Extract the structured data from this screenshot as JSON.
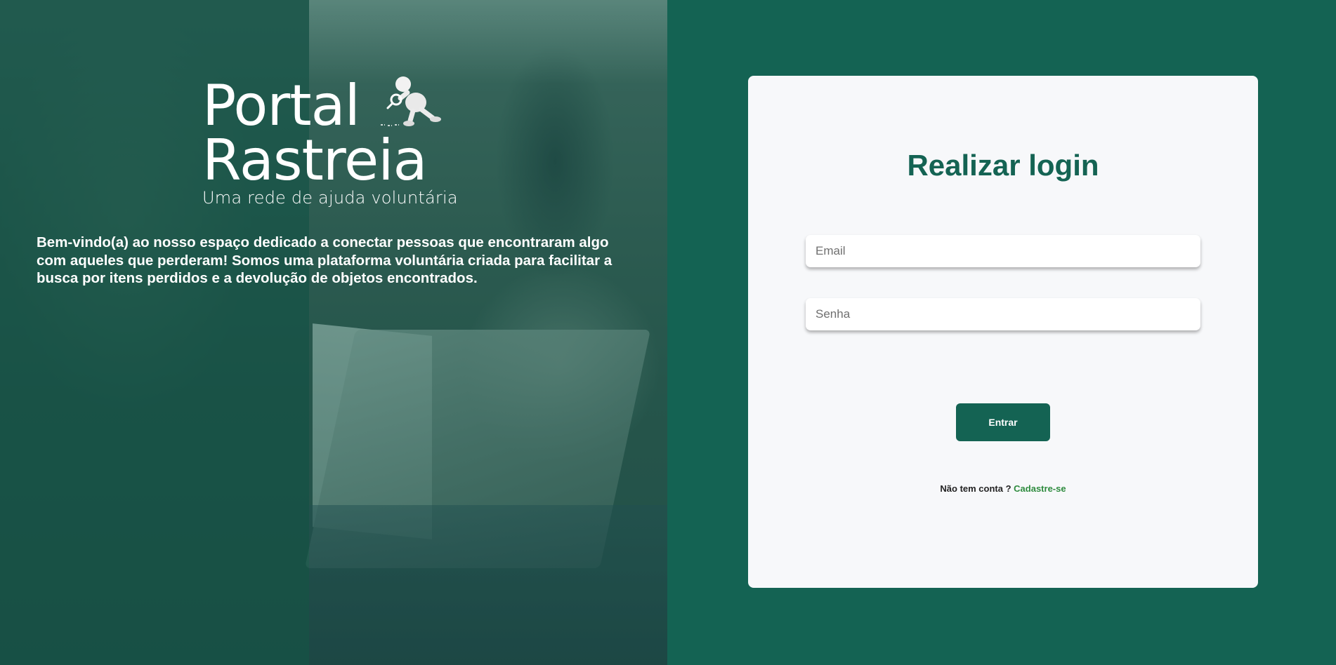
{
  "brand": {
    "line1": "Portal",
    "line2": "Rastreia",
    "tagline": "Uma rede de ajuda voluntária"
  },
  "intro": {
    "text": "Bem-vindo(a) ao nosso espaço dedicado a conectar pessoas que encontraram algo com aqueles que perderam! Somos uma plataforma voluntária criada para facilitar a busca por itens perdidos e a devolução de objetos encontrados."
  },
  "login": {
    "title": "Realizar login",
    "email_placeholder": "Email",
    "password_placeholder": "Senha",
    "submit_label": "Entrar",
    "no_account_text": "Não tem conta ? ",
    "signup_link": "Cadastre-se"
  },
  "colors": {
    "primary": "#146353",
    "card_background": "#f7f8fa",
    "link": "#2e8b3e"
  },
  "icons": {
    "mascot": "detective-magnifier-icon"
  }
}
